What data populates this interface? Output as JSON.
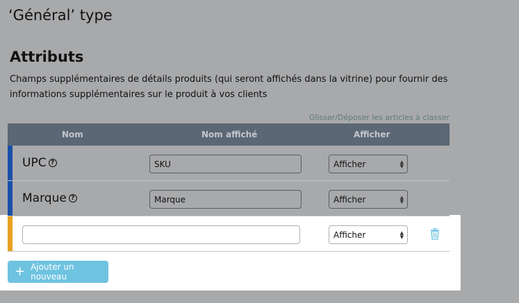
{
  "page_title": "‘Général’ type",
  "section": {
    "title": "Attributs",
    "description": "Champs supplémentaires de détails produits (qui seront affichés dans la vitrine) pour fournir des informations supplémentaires sur le produit à vos clients",
    "drag_hint": "Glisser/Déposer les articles à classer"
  },
  "table": {
    "headers": {
      "name": "Nom",
      "display_name": "Nom affiché",
      "show": "Afficher"
    },
    "rows": [
      {
        "name": "UPC",
        "display_name": "SKU",
        "show": "Afficher",
        "bar_color": "#1a4fa8"
      },
      {
        "name": "Marque",
        "display_name": "Marque",
        "show": "Afficher",
        "bar_color": "#1a4fa8"
      },
      {
        "name": "",
        "display_name": "",
        "show": "Afficher",
        "bar_color": "#e8a020"
      }
    ]
  },
  "add_button_label": "Ajouter un nouveau",
  "icons": {
    "help": "help-circle-icon",
    "trash": "trash-icon",
    "plus": "plus-icon",
    "select_arrows": "select-arrows-icon"
  }
}
